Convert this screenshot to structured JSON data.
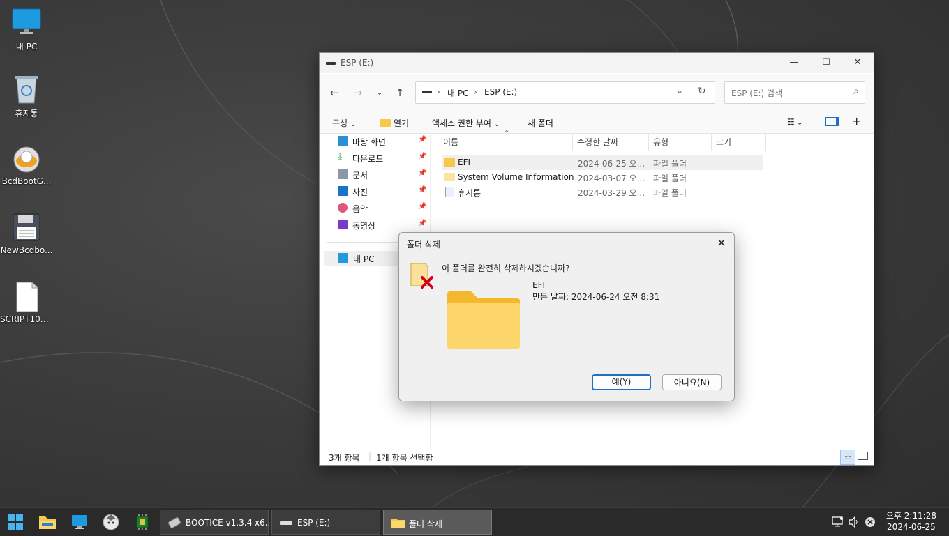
{
  "desktop": {
    "icons": [
      {
        "label": "내 PC"
      },
      {
        "label": "휴지통"
      },
      {
        "label": "BcdBootG..."
      },
      {
        "label": "NewBcdbo..."
      },
      {
        "label": "SCRIPT101..."
      }
    ]
  },
  "explorer": {
    "title": "ESP (E:)",
    "address": {
      "root": "내 PC",
      "current": "ESP (E:)"
    },
    "search_placeholder": "ESP (E:) 검색",
    "commands": {
      "organize": "구성",
      "open": "열기",
      "access": "액세스 권한 부여",
      "new_folder": "새 폴더"
    },
    "nav": {
      "quick": [
        {
          "label": "바탕 화면"
        },
        {
          "label": "다운로드"
        },
        {
          "label": "문서"
        },
        {
          "label": "사진"
        },
        {
          "label": "음악"
        },
        {
          "label": "동영상"
        }
      ],
      "this_pc": "내 PC"
    },
    "columns": {
      "name": "이름",
      "modified": "수정한 날짜",
      "type": "유형",
      "size": "크기"
    },
    "files": [
      {
        "name": "EFI",
        "modified": "2024-06-25 오...",
        "type": "파일 폴더"
      },
      {
        "name": "System Volume Information",
        "modified": "2024-03-07 오...",
        "type": "파일 폴더"
      },
      {
        "name": "휴지통",
        "modified": "2024-03-29 오...",
        "type": "파일 폴더"
      }
    ],
    "status": {
      "count": "3개 항목",
      "selected": "1개 항목 선택함"
    }
  },
  "dialog": {
    "title": "폴더 삭제",
    "question": "이 폴더를 완전히 삭제하시겠습니까?",
    "folder_name": "EFI",
    "created": "만든 날짜: 2024-06-24 오전 8:31",
    "yes": "예(Y)",
    "no": "아니요(N)"
  },
  "taskbar": {
    "windows": [
      {
        "label": "BOOTICE v1.3.4 x6..."
      },
      {
        "label": "ESP (E:)"
      },
      {
        "label": "폴더 삭제"
      }
    ],
    "clock": {
      "time": "오후 2:11:28",
      "date": "2024-06-25"
    }
  },
  "colors": {
    "accent": "#1f6fc5",
    "folder": "#f8c948",
    "delete_x": "#d0021b"
  }
}
